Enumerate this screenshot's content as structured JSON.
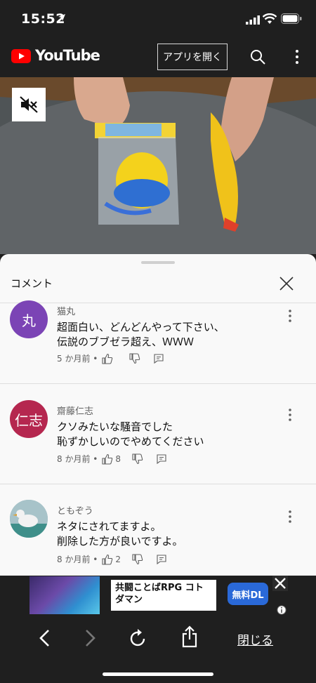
{
  "status_bar": {
    "time": "15:52"
  },
  "header": {
    "brand": "YouTube",
    "open_app_label": "アプリを開く"
  },
  "video": {
    "muted": true
  },
  "panel": {
    "title": "コメント"
  },
  "comments": [
    {
      "avatar_text": "丸",
      "avatar_color": "#7b44b5",
      "author": "猫丸",
      "line1": "超面白い、どんどんやって下さい、",
      "line2": "伝説のブブゼラ超え、ＷＷＷ",
      "age": "5 か月前 •",
      "likes": ""
    },
    {
      "avatar_text": "仁志",
      "avatar_color": "#b5274f",
      "author": "齋藤仁志",
      "line1": "クソみたいな騒音でした",
      "line2": "恥ずかしいのでやめてください",
      "age": "8 か月前 •",
      "likes": "8"
    },
    {
      "avatar_text": "",
      "avatar_color": "#8fb0b8",
      "author": "ともぞう",
      "line1": "ネタにされてますよ。",
      "line2": "削除した方が良いですよ。",
      "age": "8 か月前 •",
      "likes": "2"
    }
  ],
  "ad": {
    "text": "共闘ことばRPG コトダマン",
    "cta": "無料DL"
  },
  "toolbar": {
    "close_label": "閉じる"
  },
  "colors": {
    "youtube_red": "#ff0000",
    "ad_cta": "#2a69d8"
  }
}
